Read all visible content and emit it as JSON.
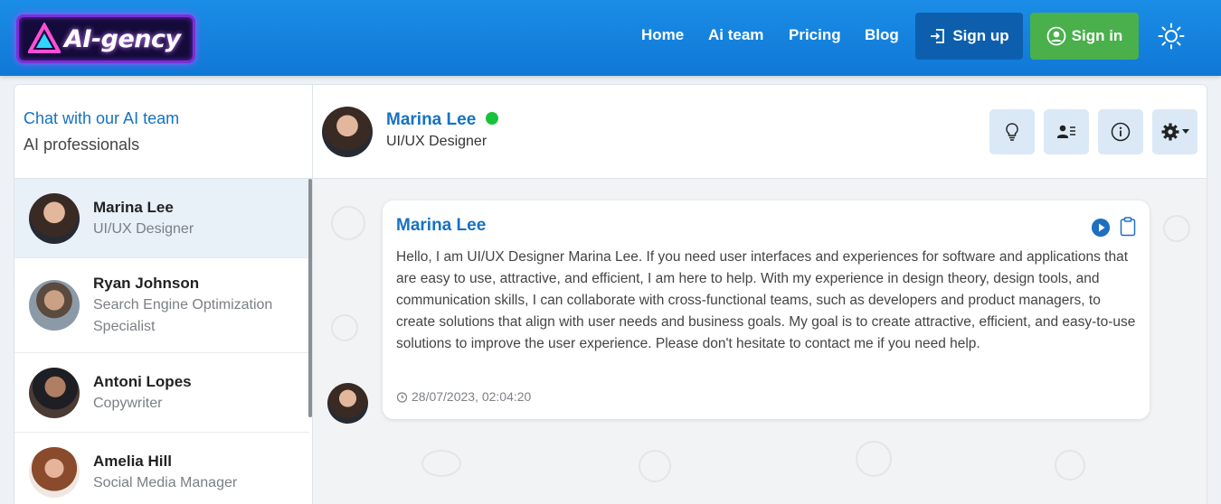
{
  "brand": {
    "name": "AI-gency"
  },
  "nav": {
    "items": [
      "Home",
      "Ai team",
      "Pricing",
      "Blog"
    ],
    "signup_label": "Sign up",
    "signin_label": "Sign in"
  },
  "sidebar": {
    "title": "Chat with our AI team",
    "subtitle": "AI professionals",
    "contacts": [
      {
        "name": "Marina Lee",
        "role": "UI/UX Designer",
        "active": true
      },
      {
        "name": "Ryan Johnson",
        "role": "Search Engine Optimization Specialist",
        "active": false
      },
      {
        "name": "Antoni Lopes",
        "role": "Copywriter",
        "active": false
      },
      {
        "name": "Amelia Hill",
        "role": "Social Media Manager",
        "active": false
      }
    ]
  },
  "chat": {
    "header": {
      "name": "Marina Lee",
      "role": "UI/UX Designer",
      "status": "online"
    },
    "actions": [
      "lightbulb-icon",
      "contact-card-icon",
      "info-icon",
      "gear-icon"
    ],
    "message": {
      "sender": "Marina Lee",
      "text": "Hello, I am UI/UX Designer Marina Lee. If you need user interfaces and experiences for software and applications that are easy to use, attractive, and efficient, I am here to help. With my experience in design theory, design tools, and communication skills, I can collaborate with cross-functional teams, such as developers and product managers, to create solutions that align with user needs and business goals. My goal is to create attractive, efficient, and easy-to-use solutions to improve the user experience. Please don't hesitate to contact me if you need help.",
      "timestamp": "28/07/2023, 02:04:20"
    }
  },
  "colors": {
    "header_blue": "#1b8de6",
    "accent_blue": "#1672c2",
    "signup_bg": "#0d5fae",
    "signin_bg": "#49b04b",
    "online": "#18c23a"
  }
}
